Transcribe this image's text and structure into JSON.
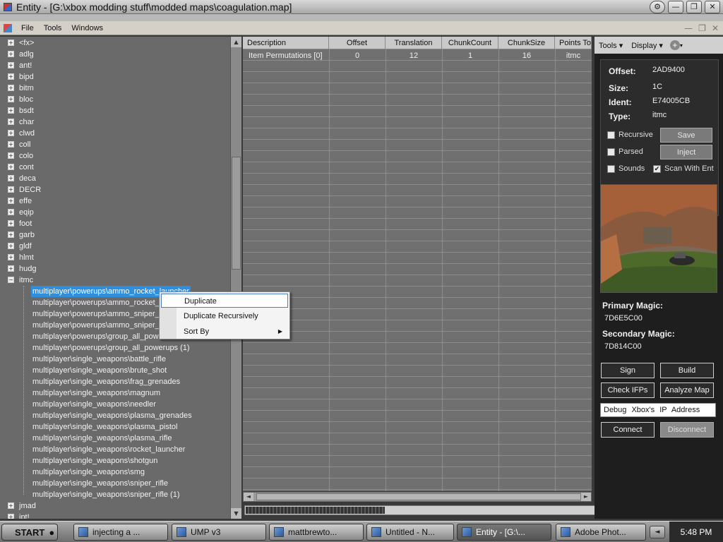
{
  "window": {
    "title": "Entity - [G:\\xbox modding stuff\\modded maps\\coagulation.map]"
  },
  "menubar": {
    "items": [
      "File",
      "Tools",
      "Windows"
    ]
  },
  "tree": {
    "top_nodes": [
      "<fx>",
      "adlg",
      "ant!",
      "bipd",
      "bitm",
      "bloc",
      "bsdt",
      "char",
      "clwd",
      "coll",
      "colo",
      "cont",
      "deca",
      "DECR",
      "effe",
      "eqip",
      "foot",
      "garb",
      "gldf",
      "hlmt",
      "hudg",
      "itmc"
    ],
    "itmc_children": [
      "multiplayer\\powerups\\ammo_rocket_launcher",
      "multiplayer\\powerups\\ammo_rocket_l",
      "multiplayer\\powerups\\ammo_sniper_ri",
      "multiplayer\\powerups\\ammo_sniper_ri",
      "multiplayer\\powerups\\group_all_powe",
      "multiplayer\\powerups\\group_all_powerups (1)",
      "multiplayer\\single_weapons\\battle_rifle",
      "multiplayer\\single_weapons\\brute_shot",
      "multiplayer\\single_weapons\\frag_grenades",
      "multiplayer\\single_weapons\\magnum",
      "multiplayer\\single_weapons\\needler",
      "multiplayer\\single_weapons\\plasma_grenades",
      "multiplayer\\single_weapons\\plasma_pistol",
      "multiplayer\\single_weapons\\plasma_rifle",
      "multiplayer\\single_weapons\\rocket_launcher",
      "multiplayer\\single_weapons\\shotgun",
      "multiplayer\\single_weapons\\smg",
      "multiplayer\\single_weapons\\sniper_rifle",
      "multiplayer\\single_weapons\\sniper_rifle (1)"
    ],
    "bottom_nodes": [
      "jmad",
      "jpt!"
    ]
  },
  "grid": {
    "columns": [
      "Description",
      "Offset",
      "Translation",
      "ChunkCount",
      "ChunkSize",
      "Points To"
    ],
    "rows": [
      [
        "Item Permutations [0]",
        "0",
        "12",
        "1",
        "16",
        "itmc"
      ]
    ]
  },
  "context_menu": {
    "items": [
      "Duplicate",
      "Duplicate Recursively",
      "Sort By"
    ]
  },
  "right_toolbar": {
    "tools": "Tools",
    "display": "Display"
  },
  "info": {
    "offset_label": "Offset:",
    "offset": "2AD9400",
    "size_label": "Size:",
    "size": "1C",
    "ident_label": "Ident:",
    "ident": "E74005CB",
    "type_label": "Type:",
    "type": "itmc",
    "recursive": "Recursive",
    "parsed": "Parsed",
    "sounds": "Sounds",
    "scan_with_ent": "Scan With Ent",
    "save": "Save",
    "inject": "Inject"
  },
  "magic": {
    "primary_label": "Primary Magic:",
    "primary": "7D6E5C00",
    "secondary_label": "Secondary Magic:",
    "secondary": "7D814C00"
  },
  "actions": {
    "sign": "Sign",
    "build": "Build",
    "check_ifps": "Check IFPs",
    "analyze_map": "Analyze Map",
    "ip_address": "Debug Xbox's IP Address",
    "connect": "Connect",
    "disconnect": "Disconnect"
  },
  "progress": {
    "fraction": 0.3
  },
  "taskbar": {
    "start": "START",
    "tasks": [
      "injecting a ...",
      "UMP v3",
      "mattbrewto...",
      "Untitled - N...",
      "Entity - [G:\\...",
      "Adobe Phot..."
    ],
    "clock": "5:48 PM"
  }
}
